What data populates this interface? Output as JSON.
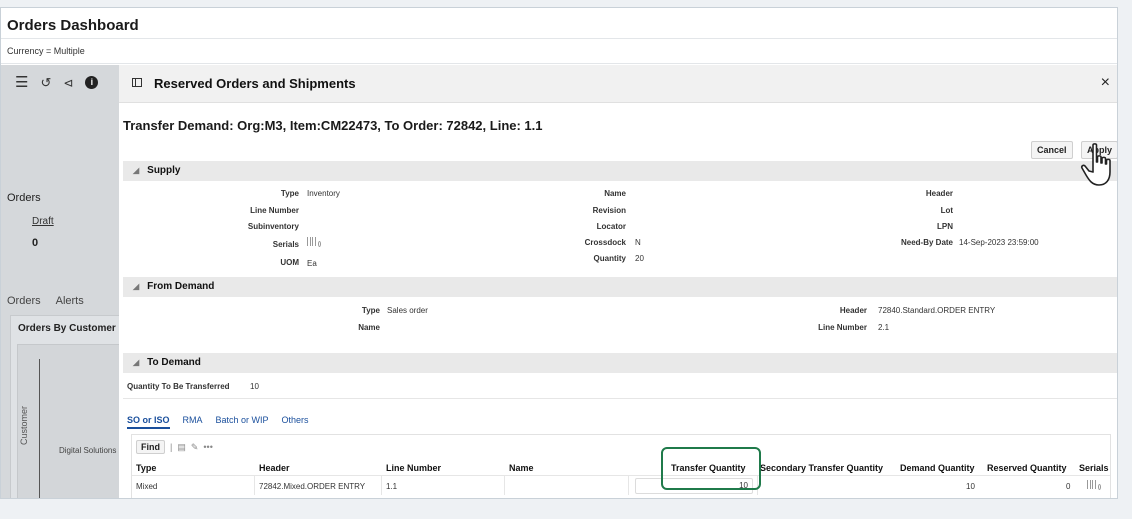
{
  "dashboard": {
    "title": "Orders Dashboard",
    "currency": "Currency = Multiple"
  },
  "icons": {
    "menu": "menu-icon",
    "undo": "undo-icon",
    "share": "share-icon",
    "info": "info-icon"
  },
  "left_panel": {
    "orders_heading": "Orders",
    "draft_label": "Draft",
    "draft_count": "0",
    "tabs": [
      "Orders",
      "Alerts"
    ],
    "card_title": "Orders By Customer",
    "axis_label": "Customer",
    "category": "Digital Solutions"
  },
  "dialog": {
    "title": "Reserved Orders and Shipments",
    "close": "×",
    "transfer_title": "Transfer Demand: Org:M3, Item:CM22473, To Order: 72842, Line: 1.1",
    "cancel": "Cancel",
    "apply": "Apply"
  },
  "supply": {
    "heading": "Supply",
    "type_label": "Type",
    "type_value": "Inventory",
    "line_number_label": "Line Number",
    "subinventory_label": "Subinventory",
    "serials_label": "Serials",
    "uom_label": "UOM",
    "uom_value": "Ea",
    "name_label": "Name",
    "revision_label": "Revision",
    "locator_label": "Locator",
    "crossdock_label": "Crossdock",
    "crossdock_value": "N",
    "quantity_label": "Quantity",
    "quantity_value": "20",
    "header_label": "Header",
    "lot_label": "Lot",
    "lpn_label": "LPN",
    "need_by_label": "Need-By Date",
    "need_by_value": "14-Sep-2023 23:59:00"
  },
  "from_demand": {
    "heading": "From Demand",
    "type_label": "Type",
    "type_value": "Sales order",
    "name_label": "Name",
    "header_label": "Header",
    "header_value": "72840.Standard.ORDER ENTRY",
    "line_number_label": "Line Number",
    "line_number_value": "2.1"
  },
  "to_demand": {
    "heading": "To Demand",
    "qty_label": "Quantity To Be Transferred",
    "qty_value": "10",
    "tabs": [
      "SO or ISO",
      "RMA",
      "Batch or WIP",
      "Others"
    ],
    "find": "Find",
    "columns": [
      "Type",
      "Header",
      "Line Number",
      "Name",
      "Transfer Quantity",
      "Secondary Transfer Quantity",
      "Demand Quantity",
      "Reserved Quantity",
      "Serials"
    ],
    "row": {
      "type": "Mixed",
      "header": "72842.Mixed.ORDER ENTRY",
      "line_number": "1.1",
      "name": "",
      "transfer_quantity": "10",
      "secondary_transfer_quantity": "",
      "demand_quantity": "10",
      "reserved_quantity": "0"
    }
  },
  "colors": {
    "highlight": "#1f7a4a",
    "link": "#1a4f9c"
  }
}
